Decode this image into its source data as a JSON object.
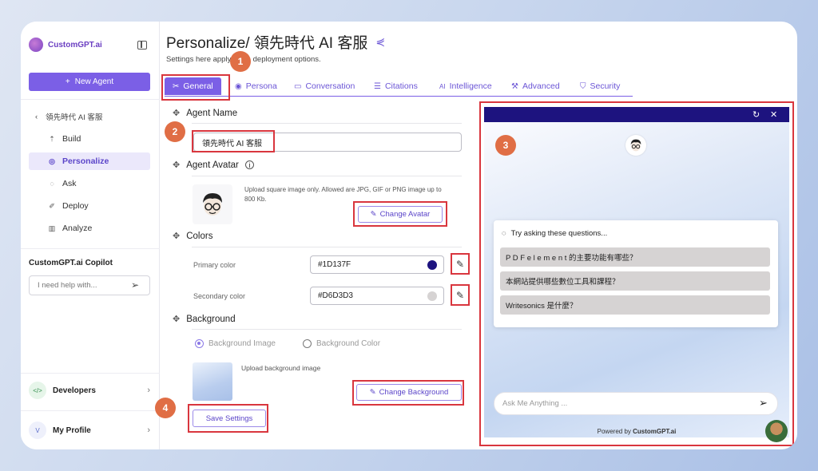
{
  "sidebar": {
    "brand": "CustomGPT.ai",
    "new_agent": "New Agent",
    "back_label": "領先時代 AI 客服",
    "nav": [
      {
        "label": "Build",
        "icon": "build-icon"
      },
      {
        "label": "Personalize",
        "icon": "palette-icon"
      },
      {
        "label": "Ask",
        "icon": "chat-icon"
      },
      {
        "label": "Deploy",
        "icon": "rocket-icon"
      },
      {
        "label": "Analyze",
        "icon": "chart-icon"
      }
    ],
    "copilot_title": "CustomGPT.ai Copilot",
    "copilot_placeholder": "I need help with...",
    "developers": "Developers",
    "developers_icon": "</>",
    "profile": "My Profile",
    "profile_initial": "V"
  },
  "header": {
    "title": "Personalize/ 領先時代 AI 客服",
    "subtitle_a": "Settings here apply",
    "subtitle_b": "deployment options."
  },
  "tabs": [
    {
      "label": "General",
      "icon": "tools-icon"
    },
    {
      "label": "Persona",
      "icon": "persona-icon"
    },
    {
      "label": "Conversation",
      "icon": "conversation-icon"
    },
    {
      "label": "Citations",
      "icon": "citations-icon"
    },
    {
      "label": "Intelligence",
      "icon": "ai-icon"
    },
    {
      "label": "Advanced",
      "icon": "wrench-icon"
    },
    {
      "label": "Security",
      "icon": "shield-icon"
    }
  ],
  "form": {
    "agent_name_label": "Agent Name",
    "agent_name_value": "領先時代 AI 客服",
    "avatar_label": "Agent Avatar",
    "avatar_hint": "Upload square image only. Allowed are JPG, GIF or PNG image up to 800 Kb.",
    "change_avatar": "Change Avatar",
    "colors_label": "Colors",
    "primary_label": "Primary color",
    "primary_value": "#1D137F",
    "secondary_label": "Secondary color",
    "secondary_value": "#D6D3D3",
    "background_label": "Background",
    "bg_image_option": "Background Image",
    "bg_color_option": "Background Color",
    "upload_bg": "Upload background image",
    "change_bg": "Change Background",
    "save": "Save Settings"
  },
  "preview": {
    "suggest_title": "Try asking these questions...",
    "questions": [
      "P D F e l e m e n t 的主要功能有哪些？",
      "本網站提供哪些數位工具和課程？",
      "Writesonics 是什麼？"
    ],
    "ask_placeholder": "Ask Me Anything ...",
    "powered_prefix": "Powered by ",
    "powered_brand": "CustomGPT.ai"
  },
  "annotations": [
    "1",
    "2",
    "3",
    "4"
  ],
  "colors": {
    "accent": "#7b5fe6",
    "primary": "#1D137F",
    "secondary": "#D6D3D3",
    "annotation": "#d9363e"
  }
}
